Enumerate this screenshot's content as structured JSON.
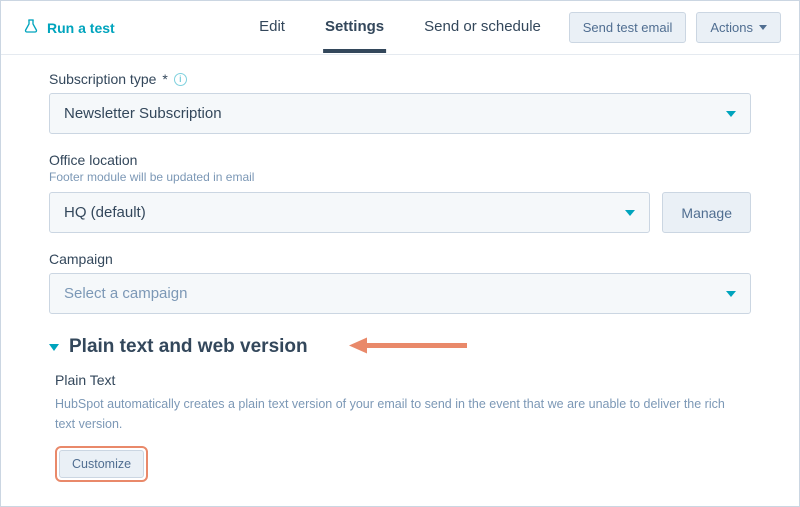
{
  "topbar": {
    "run_test_label": "Run a test",
    "tabs": [
      {
        "label": "Edit",
        "active": false
      },
      {
        "label": "Settings",
        "active": true
      },
      {
        "label": "Send or schedule",
        "active": false
      }
    ],
    "send_test_label": "Send test email",
    "actions_label": "Actions"
  },
  "fields": {
    "subscription": {
      "label": "Subscription type",
      "required_marker": "*",
      "value": "Newsletter Subscription"
    },
    "office": {
      "label": "Office location",
      "helper": "Footer module will be updated in email",
      "value": "HQ (default)",
      "manage_label": "Manage"
    },
    "campaign": {
      "label": "Campaign",
      "placeholder": "Select a campaign"
    }
  },
  "section": {
    "title": "Plain text and web version",
    "plain_text": {
      "label": "Plain Text",
      "description": "HubSpot automatically creates a plain text version of your email to send in the event that we are unable to deliver the rich text version.",
      "customize_label": "Customize"
    }
  },
  "colors": {
    "accent": "#00a4bd",
    "annotation": "#e9896a"
  }
}
